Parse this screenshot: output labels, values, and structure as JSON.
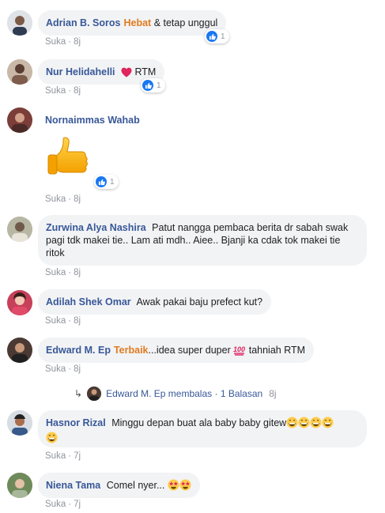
{
  "like_label": "Suka",
  "comments": [
    {
      "name": "Adrian B. Soros",
      "badge": "Hebat",
      "text": "& tetap unggul",
      "time": "8j",
      "reactions": "1"
    },
    {
      "name": "Nur Helidahelli",
      "text": "RTM",
      "time": "8j",
      "reactions": "1",
      "emoji": "red-heart"
    },
    {
      "name": "Nornaimmas Wahab",
      "text": "",
      "time": "8j",
      "reactions": "1",
      "sticker": "thumbs-up"
    },
    {
      "name": "Zurwina Alya Nashira",
      "text": "Patut nangga pembaca berita dr sabah swak pagi tdk makei tie.. Lam ati mdh.. Aiee.. Bjanji ka cdak tok makei tie ritok",
      "time": "8j"
    },
    {
      "name": "Adilah Shek Omar",
      "text": "Awak pakai baju prefect kut?",
      "time": "8j"
    },
    {
      "name": "Edward M. Ep",
      "badge": "Terbaik",
      "text_before": "...idea super duper",
      "emoji": "hundred-points",
      "text_after": "tahniah RTM",
      "time": "8j"
    },
    {
      "name": "Hasnor Rizal",
      "text": "Minggu depan buat ala baby baby gitew",
      "time": "7j",
      "emoji": "grinning-face"
    },
    {
      "name": "Niena Tama",
      "text": "Comel nyer...",
      "time": "7j",
      "emoji": "star-struck"
    }
  ],
  "reply_summary": {
    "name": "Edward M. Ep",
    "label": "membalas",
    "count": "1 Balasan",
    "time": "8j"
  },
  "colors": {
    "name": "#385898",
    "badge": "#e07b1f",
    "bubble": "#f2f3f5",
    "meta": "#90949c",
    "like": "#1877f2"
  }
}
